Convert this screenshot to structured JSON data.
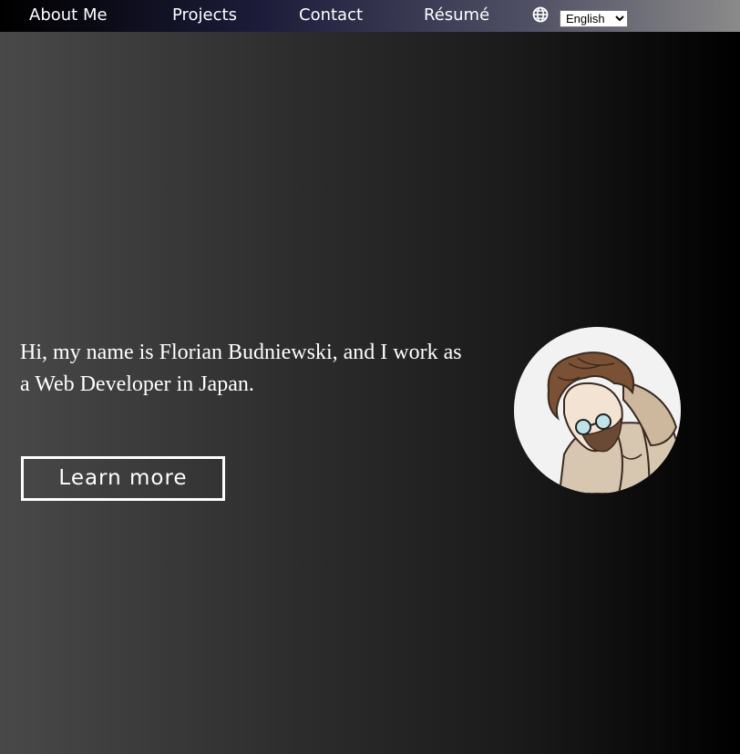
{
  "nav": {
    "items": [
      {
        "label": "About Me"
      },
      {
        "label": "Projects"
      },
      {
        "label": "Contact"
      },
      {
        "label": "Résumé"
      }
    ],
    "language_icon": "globe-icon",
    "language_select": {
      "selected": "English"
    }
  },
  "hero": {
    "intro": "Hi, my name is Florian Budniewski, and I work as a Web Developer in Japan.",
    "cta_label": "Learn more",
    "avatar_icon": "avatar-illustration"
  },
  "colors": {
    "nav_gradient_start": "#000000",
    "nav_gradient_mid": "#1c1c3a",
    "nav_gradient_end": "#8a8a8a",
    "bg_gradient_start": "#494949",
    "bg_gradient_end": "#000000",
    "text": "#ffffff"
  }
}
